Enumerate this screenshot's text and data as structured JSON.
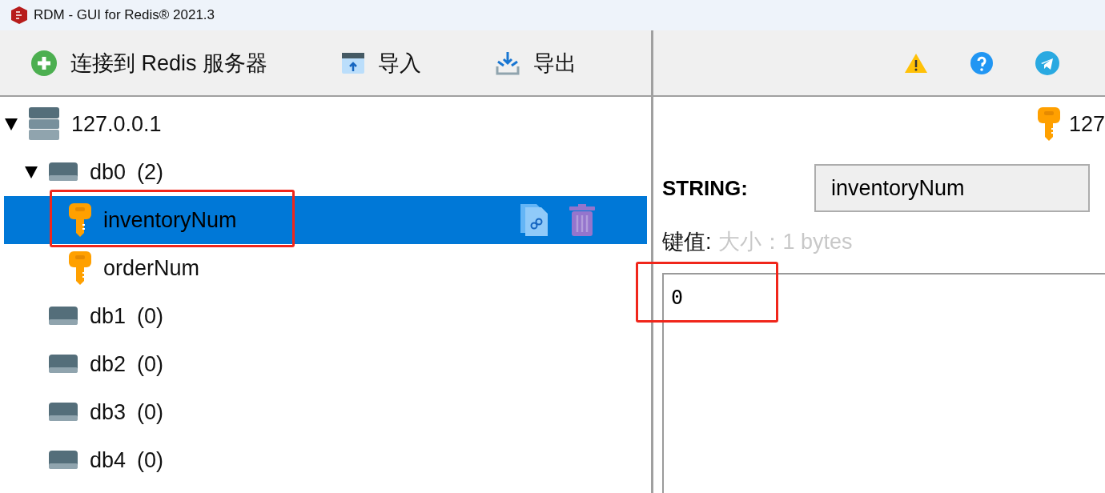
{
  "window": {
    "title": "RDM - GUI for Redis® 2021.3"
  },
  "toolbar": [
    {
      "kind": "connect",
      "label": "连接到 Redis 服务器"
    },
    {
      "kind": "import",
      "label": "导入"
    },
    {
      "kind": "export",
      "label": "导出"
    }
  ],
  "toolbar_right": [
    {
      "kind": "warning"
    },
    {
      "kind": "help"
    },
    {
      "kind": "telegram"
    }
  ],
  "tree": [
    {
      "kind": "server",
      "label": "127.0.0.1",
      "expanded": true,
      "children": [
        {
          "kind": "db",
          "label": "db0",
          "count": "(2)",
          "expanded": true,
          "children": [
            {
              "kind": "key",
              "label": "inventoryNum",
              "selected": true,
              "highlighted": true
            },
            {
              "kind": "key",
              "label": "orderNum",
              "selected": false,
              "highlighted": false
            }
          ]
        },
        {
          "kind": "db",
          "label": "db1",
          "count": "(0)"
        },
        {
          "kind": "db",
          "label": "db2",
          "count": "(0)"
        },
        {
          "kind": "db",
          "label": "db3",
          "count": "(0)"
        },
        {
          "kind": "db",
          "label": "db4",
          "count": "(0)"
        }
      ]
    }
  ],
  "tab": {
    "label": "127"
  },
  "key_type": "STRING:",
  "key_name": "inventoryNum",
  "value_label": "键值:",
  "value_size": "大小：1 bytes",
  "value": {
    "text": "0",
    "highlighted": true
  }
}
